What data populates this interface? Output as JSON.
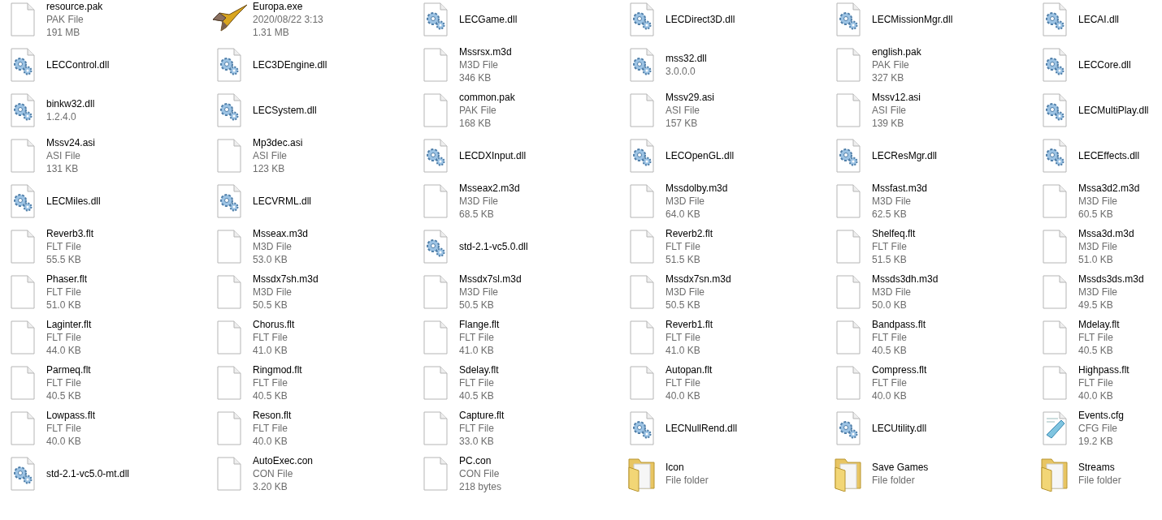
{
  "items": [
    {
      "kind": "file",
      "name": "resource.pak",
      "details": [
        "PAK File",
        "191 MB"
      ]
    },
    {
      "kind": "exe",
      "name": "Europa.exe",
      "details": [
        "2020/08/22 3:13",
        "1.31 MB"
      ]
    },
    {
      "kind": "dll",
      "name": "LECGame.dll"
    },
    {
      "kind": "dll",
      "name": "LECDirect3D.dll"
    },
    {
      "kind": "dll",
      "name": "LECMissionMgr.dll"
    },
    {
      "kind": "dll",
      "name": "LECAI.dll"
    },
    {
      "kind": "dll",
      "name": "LECControl.dll"
    },
    {
      "kind": "dll",
      "name": "LEC3DEngine.dll"
    },
    {
      "kind": "file",
      "name": "Mssrsx.m3d",
      "details": [
        "M3D File",
        "346 KB"
      ]
    },
    {
      "kind": "dll",
      "name": "mss32.dll",
      "details": [
        "3.0.0.0"
      ]
    },
    {
      "kind": "file",
      "name": "english.pak",
      "details": [
        "PAK File",
        "327 KB"
      ]
    },
    {
      "kind": "dll",
      "name": "LECCore.dll"
    },
    {
      "kind": "dll",
      "name": "binkw32.dll",
      "details": [
        "1.2.4.0"
      ]
    },
    {
      "kind": "dll",
      "name": "LECSystem.dll"
    },
    {
      "kind": "file",
      "name": "common.pak",
      "details": [
        "PAK File",
        "168 KB"
      ]
    },
    {
      "kind": "file",
      "name": "Mssv29.asi",
      "details": [
        "ASI File",
        "157 KB"
      ]
    },
    {
      "kind": "file",
      "name": "Mssv12.asi",
      "details": [
        "ASI File",
        "139 KB"
      ]
    },
    {
      "kind": "dll",
      "name": "LECMultiPlay.dll"
    },
    {
      "kind": "file",
      "name": "Mssv24.asi",
      "details": [
        "ASI File",
        "131 KB"
      ]
    },
    {
      "kind": "file",
      "name": "Mp3dec.asi",
      "details": [
        "ASI File",
        "123 KB"
      ]
    },
    {
      "kind": "dll",
      "name": "LECDXInput.dll"
    },
    {
      "kind": "dll",
      "name": "LECOpenGL.dll"
    },
    {
      "kind": "dll",
      "name": "LECResMgr.dll"
    },
    {
      "kind": "dll",
      "name": "LECEffects.dll"
    },
    {
      "kind": "dll",
      "name": "LECMiles.dll"
    },
    {
      "kind": "dll",
      "name": "LECVRML.dll"
    },
    {
      "kind": "file",
      "name": "Msseax2.m3d",
      "details": [
        "M3D File",
        "68.5 KB"
      ]
    },
    {
      "kind": "file",
      "name": "Mssdolby.m3d",
      "details": [
        "M3D File",
        "64.0 KB"
      ]
    },
    {
      "kind": "file",
      "name": "Mssfast.m3d",
      "details": [
        "M3D File",
        "62.5 KB"
      ]
    },
    {
      "kind": "file",
      "name": "Mssa3d2.m3d",
      "details": [
        "M3D File",
        "60.5 KB"
      ]
    },
    {
      "kind": "file",
      "name": "Reverb3.flt",
      "details": [
        "FLT File",
        "55.5 KB"
      ]
    },
    {
      "kind": "file",
      "name": "Msseax.m3d",
      "details": [
        "M3D File",
        "53.0 KB"
      ]
    },
    {
      "kind": "dll",
      "name": "std-2.1-vc5.0.dll"
    },
    {
      "kind": "file",
      "name": "Reverb2.flt",
      "details": [
        "FLT File",
        "51.5 KB"
      ]
    },
    {
      "kind": "file",
      "name": "Shelfeq.flt",
      "details": [
        "FLT File",
        "51.5 KB"
      ]
    },
    {
      "kind": "file",
      "name": "Mssa3d.m3d",
      "details": [
        "M3D File",
        "51.0 KB"
      ]
    },
    {
      "kind": "file",
      "name": "Phaser.flt",
      "details": [
        "FLT File",
        "51.0 KB"
      ]
    },
    {
      "kind": "file",
      "name": "Mssdx7sh.m3d",
      "details": [
        "M3D File",
        "50.5 KB"
      ]
    },
    {
      "kind": "file",
      "name": "Mssdx7sl.m3d",
      "details": [
        "M3D File",
        "50.5 KB"
      ]
    },
    {
      "kind": "file",
      "name": "Mssdx7sn.m3d",
      "details": [
        "M3D File",
        "50.5 KB"
      ]
    },
    {
      "kind": "file",
      "name": "Mssds3dh.m3d",
      "details": [
        "M3D File",
        "50.0 KB"
      ]
    },
    {
      "kind": "file",
      "name": "Mssds3ds.m3d",
      "details": [
        "M3D File",
        "49.5 KB"
      ]
    },
    {
      "kind": "file",
      "name": "Laginter.flt",
      "details": [
        "FLT File",
        "44.0 KB"
      ]
    },
    {
      "kind": "file",
      "name": "Chorus.flt",
      "details": [
        "FLT File",
        "41.0 KB"
      ]
    },
    {
      "kind": "file",
      "name": "Flange.flt",
      "details": [
        "FLT File",
        "41.0 KB"
      ]
    },
    {
      "kind": "file",
      "name": "Reverb1.flt",
      "details": [
        "FLT File",
        "41.0 KB"
      ]
    },
    {
      "kind": "file",
      "name": "Bandpass.flt",
      "details": [
        "FLT File",
        "40.5 KB"
      ]
    },
    {
      "kind": "file",
      "name": "Mdelay.flt",
      "details": [
        "FLT File",
        "40.5 KB"
      ]
    },
    {
      "kind": "file",
      "name": "Parmeq.flt",
      "details": [
        "FLT File",
        "40.5 KB"
      ]
    },
    {
      "kind": "file",
      "name": "Ringmod.flt",
      "details": [
        "FLT File",
        "40.5 KB"
      ]
    },
    {
      "kind": "file",
      "name": "Sdelay.flt",
      "details": [
        "FLT File",
        "40.5 KB"
      ]
    },
    {
      "kind": "file",
      "name": "Autopan.flt",
      "details": [
        "FLT File",
        "40.0 KB"
      ]
    },
    {
      "kind": "file",
      "name": "Compress.flt",
      "details": [
        "FLT File",
        "40.0 KB"
      ]
    },
    {
      "kind": "file",
      "name": "Highpass.flt",
      "details": [
        "FLT File",
        "40.0 KB"
      ]
    },
    {
      "kind": "file",
      "name": "Lowpass.flt",
      "details": [
        "FLT File",
        "40.0 KB"
      ]
    },
    {
      "kind": "file",
      "name": "Reson.flt",
      "details": [
        "FLT File",
        "40.0 KB"
      ]
    },
    {
      "kind": "file",
      "name": "Capture.flt",
      "details": [
        "FLT File",
        "33.0 KB"
      ]
    },
    {
      "kind": "dll",
      "name": "LECNullRend.dll"
    },
    {
      "kind": "dll",
      "name": "LECUtility.dll"
    },
    {
      "kind": "cfg",
      "name": "Events.cfg",
      "details": [
        "CFG File",
        "19.2 KB"
      ]
    },
    {
      "kind": "dll",
      "name": "std-2.1-vc5.0-mt.dll"
    },
    {
      "kind": "file",
      "name": "AutoExec.con",
      "details": [
        "CON File",
        "3.20 KB"
      ]
    },
    {
      "kind": "file",
      "name": "PC.con",
      "details": [
        "CON File",
        "218 bytes"
      ]
    },
    {
      "kind": "folder",
      "name": "Icon",
      "details": [
        "File folder"
      ]
    },
    {
      "kind": "folder",
      "name": "Save Games",
      "details": [
        "File folder"
      ]
    },
    {
      "kind": "folder",
      "name": "Streams",
      "details": [
        "File folder"
      ]
    }
  ]
}
